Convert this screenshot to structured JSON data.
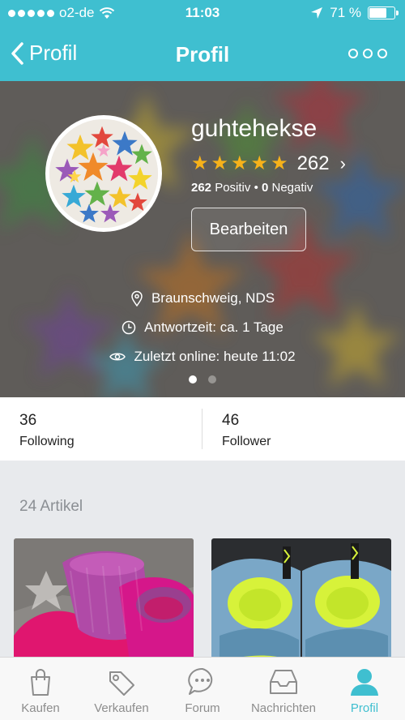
{
  "status_bar": {
    "carrier": "o2-de",
    "time": "11:03",
    "battery": "71 %",
    "battery_level": 0.71
  },
  "navbar": {
    "back_label": "Profil",
    "title": "Profil"
  },
  "profile": {
    "username": "guhtehekse",
    "rating_stars": 5,
    "rating_count": "262",
    "positive_count": "262",
    "positive_label": "Positiv",
    "negative_count": "0",
    "negative_label": "Negativ",
    "edit_label": "Bearbeiten",
    "location": "Braunschweig, NDS",
    "response_time": "Antwortzeit: ca. 1 Tage",
    "last_online": "Zuletzt online: heute 11:02",
    "pager_total": 2,
    "pager_active": 1
  },
  "stats": {
    "following_count": "36",
    "following_label": "Following",
    "follower_count": "46",
    "follower_label": "Follower"
  },
  "articles": {
    "title": "24 Artikel"
  },
  "tabbar": {
    "items": [
      {
        "label": "Kaufen",
        "icon": "shopping-bag-icon"
      },
      {
        "label": "Verkaufen",
        "icon": "price-tag-icon"
      },
      {
        "label": "Forum",
        "icon": "chat-bubble-icon"
      },
      {
        "label": "Nachrichten",
        "icon": "inbox-icon"
      },
      {
        "label": "Profil",
        "icon": "person-icon"
      }
    ],
    "active": "Profil"
  },
  "colors": {
    "brand": "#3fbfd0",
    "star": "#f6b21a"
  }
}
